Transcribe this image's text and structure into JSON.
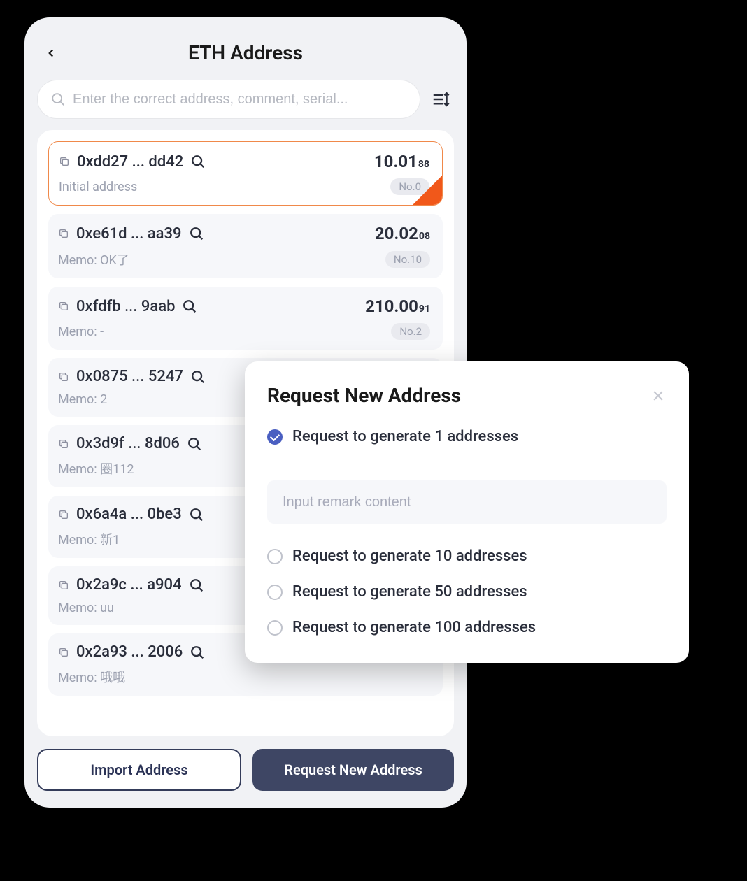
{
  "header": {
    "title": "ETH Address"
  },
  "search": {
    "placeholder": "Enter the correct address, comment, serial..."
  },
  "addresses": [
    {
      "addr": "0xdd27 ... dd42",
      "memo": "Initial address",
      "bal": "10.01",
      "baldec": "88",
      "no": "No.0",
      "selected": true
    },
    {
      "addr": "0xe61d ... aa39",
      "memo": "Memo: OK了",
      "bal": "20.02",
      "baldec": "08",
      "no": "No.10",
      "selected": false
    },
    {
      "addr": "0xfdfb ... 9aab",
      "memo": "Memo: -",
      "bal": "210.00",
      "baldec": "91",
      "no": "No.2",
      "selected": false
    },
    {
      "addr": "0x0875 ... 5247",
      "memo": "Memo: 2",
      "bal": "",
      "baldec": "",
      "no": "",
      "selected": false
    },
    {
      "addr": "0x3d9f ... 8d06",
      "memo": "Memo: 圈112",
      "bal": "",
      "baldec": "",
      "no": "",
      "selected": false
    },
    {
      "addr": "0x6a4a ... 0be3",
      "memo": "Memo: 新1",
      "bal": "",
      "baldec": "",
      "no": "",
      "selected": false
    },
    {
      "addr": "0x2a9c ... a904",
      "memo": "Memo: uu",
      "bal": "",
      "baldec": "",
      "no": "",
      "selected": false
    },
    {
      "addr": "0x2a93 ... 2006",
      "memo": "Memo: 哦哦",
      "bal": "",
      "baldec": "",
      "no": "",
      "selected": false
    }
  ],
  "buttons": {
    "import": "Import Address",
    "request": "Request New Address"
  },
  "modal": {
    "title": "Request New Address",
    "remark_placeholder": "Input remark content",
    "options": [
      {
        "label": "Request to generate 1 addresses",
        "checked": true
      },
      {
        "label": "Request to generate 10 addresses",
        "checked": false
      },
      {
        "label": "Request to generate 50 addresses",
        "checked": false
      },
      {
        "label": "Request to generate 100 addresses",
        "checked": false
      }
    ]
  }
}
